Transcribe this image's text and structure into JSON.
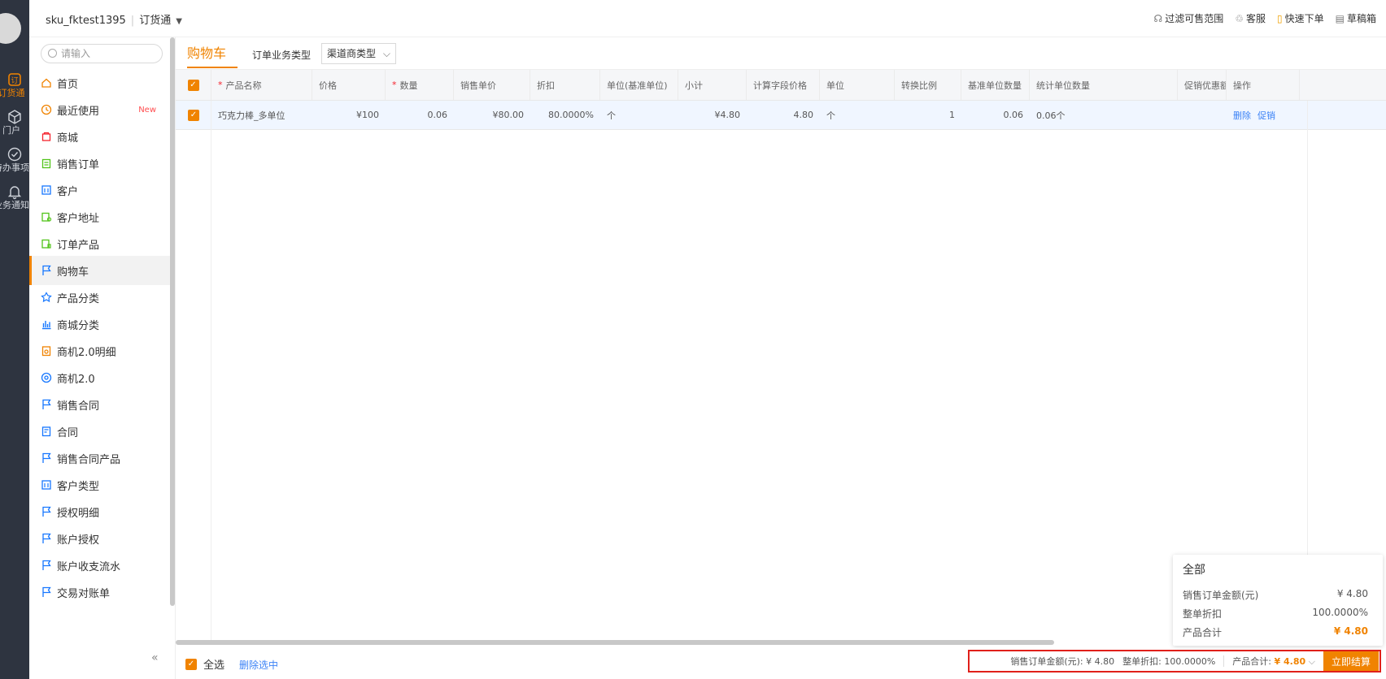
{
  "rail": {
    "items": [
      {
        "label": "订货通",
        "icon": "order-icon"
      },
      {
        "label": "门户",
        "icon": "cube-icon"
      },
      {
        "label": "待办事项",
        "icon": "check-circle-icon"
      },
      {
        "label": "业务通知",
        "icon": "bell-icon"
      }
    ]
  },
  "topbar": {
    "account": "sku_fktest1395",
    "app": "订货通",
    "right": [
      {
        "label": "过滤可售范围",
        "icon": "headset-icon"
      },
      {
        "label": "客服",
        "icon": "support-icon"
      },
      {
        "label": "快速下单",
        "icon": "quick-order-icon"
      },
      {
        "label": "草稿箱",
        "icon": "draft-icon"
      }
    ]
  },
  "sidebar": {
    "search_placeholder": "请输入",
    "items": [
      {
        "label": "首页",
        "icon": "home-icon",
        "color": "#f08300"
      },
      {
        "label": "最近使用",
        "icon": "clock-icon",
        "color": "#f08300",
        "badge": "New"
      },
      {
        "label": "商城",
        "icon": "shop-icon",
        "color": "#f5222d"
      },
      {
        "label": "销售订单",
        "icon": "clipboard-icon",
        "color": "#52c41a"
      },
      {
        "label": "客户",
        "icon": "building-icon",
        "color": "#1677ff"
      },
      {
        "label": "客户地址",
        "icon": "address-icon",
        "color": "#52c41a"
      },
      {
        "label": "订单产品",
        "icon": "product-icon",
        "color": "#52c41a"
      },
      {
        "label": "购物车",
        "icon": "flag-icon",
        "color": "#1677ff",
        "active": true
      },
      {
        "label": "产品分类",
        "icon": "category-icon",
        "color": "#1677ff"
      },
      {
        "label": "商城分类",
        "icon": "bar-chart-icon",
        "color": "#1677ff"
      },
      {
        "label": "商机2.0明细",
        "icon": "detail-icon",
        "color": "#f08300"
      },
      {
        "label": "商机2.0",
        "icon": "target-icon",
        "color": "#1677ff"
      },
      {
        "label": "销售合同",
        "icon": "flag-icon",
        "color": "#1677ff"
      },
      {
        "label": "合同",
        "icon": "contract-icon",
        "color": "#1677ff"
      },
      {
        "label": "销售合同产品",
        "icon": "flag-icon",
        "color": "#1677ff"
      },
      {
        "label": "客户类型",
        "icon": "building-icon",
        "color": "#1677ff"
      },
      {
        "label": "授权明细",
        "icon": "flag-icon",
        "color": "#1677ff"
      },
      {
        "label": "账户授权",
        "icon": "flag-icon",
        "color": "#1677ff"
      },
      {
        "label": "账户收支流水",
        "icon": "flag-icon",
        "color": "#1677ff"
      },
      {
        "label": "交易对账单",
        "icon": "flag-icon",
        "color": "#1677ff"
      }
    ],
    "collapse": "«"
  },
  "main": {
    "tab": "购物车",
    "type_label": "订单业务类型",
    "type_value": "渠道商类型"
  },
  "table": {
    "columns": [
      {
        "label": "产品名称",
        "required": true
      },
      {
        "label": "价格"
      },
      {
        "label": "数量",
        "required": true
      },
      {
        "label": "销售单价"
      },
      {
        "label": "折扣"
      },
      {
        "label": "单位(基准单位)"
      },
      {
        "label": "小计"
      },
      {
        "label": "计算字段价格"
      },
      {
        "label": "单位"
      },
      {
        "label": "转换比例"
      },
      {
        "label": "基准单位数量"
      },
      {
        "label": "统计单位数量"
      },
      {
        "label": "促销优惠额"
      },
      {
        "label": "操作"
      }
    ],
    "rows": [
      {
        "name": "巧克力棒_多单位",
        "price": "¥100",
        "qty": "0.06",
        "unit_price": "¥80.00",
        "discount": "80.0000%",
        "base_unit": "个",
        "subtotal": "¥4.80",
        "calc_price": "4.80",
        "unit": "个",
        "ratio": "1",
        "base_qty": "0.06",
        "stat_qty": "0.06个",
        "promo": "",
        "actions": [
          "删除",
          "促销"
        ]
      }
    ]
  },
  "bottom": {
    "select_all": "全选",
    "delete_selected": "删除选中",
    "amount_label": "销售订单金额(元):",
    "amount": "¥ 4.80",
    "discount_label": "整单折扣:",
    "discount": "100.0000%",
    "total_label": "产品合计:",
    "total": "¥ 4.80",
    "submit": "立即结算"
  },
  "popup": {
    "title": "全部",
    "rows": [
      {
        "label": "销售订单金额(元)",
        "value": "¥ 4.80"
      },
      {
        "label": "整单折扣",
        "value": "100.0000%"
      },
      {
        "label": "产品合计",
        "value": "¥ 4.80"
      }
    ]
  },
  "colors": {
    "accent": "#f08300",
    "link": "#3b82f6",
    "highlight_border": "#e0201a"
  }
}
